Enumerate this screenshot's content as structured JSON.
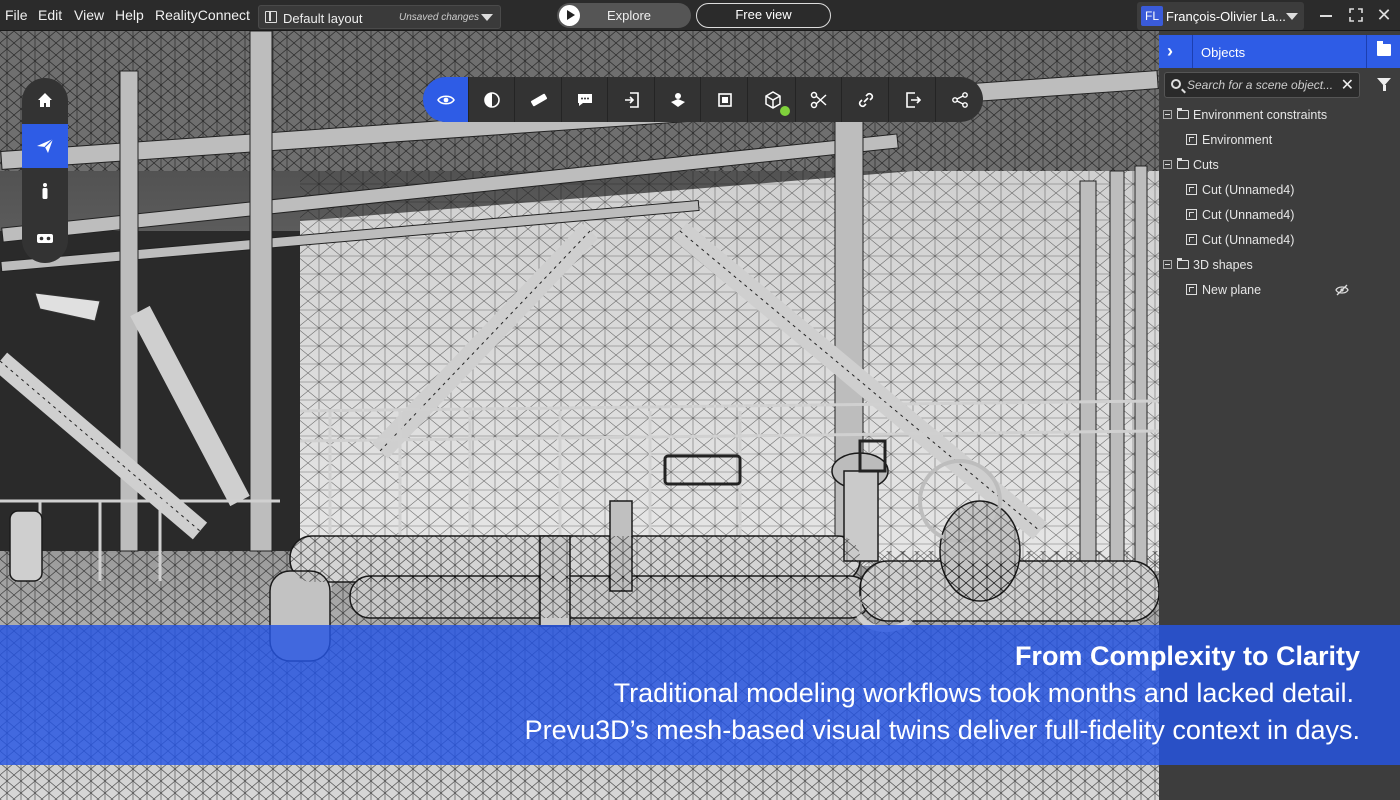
{
  "menu": {
    "file": "File",
    "edit": "Edit",
    "view": "View",
    "help": "Help",
    "reality_connect": "RealityConnect"
  },
  "layout": {
    "name": "Default layout",
    "status": "Unsaved changes"
  },
  "modes": {
    "explore": "Explore",
    "free_view": "Free view"
  },
  "user": {
    "initials": "FL",
    "name": "François-Olivier La..."
  },
  "left_nav": {
    "items": [
      "home-icon",
      "paper-plane-icon",
      "person-icon",
      "vr-headset-icon"
    ],
    "active": "paper-plane-icon"
  },
  "toolbar": {
    "tools": [
      "eye-icon",
      "contrast-icon",
      "ruler-icon",
      "comment-icon",
      "import-icon",
      "hotspot-icon",
      "frame-icon",
      "cube-icon",
      "scissors-icon",
      "link-icon",
      "export-icon",
      "share-icon"
    ],
    "active": "eye-icon",
    "status_dot_color": "#7fd13b"
  },
  "panel": {
    "title": "Objects",
    "search_placeholder": "Search for a scene object...",
    "tree": [
      {
        "type": "group",
        "label": "Environment constraints"
      },
      {
        "type": "item",
        "label": "Environment"
      },
      {
        "type": "group",
        "label": "Cuts"
      },
      {
        "type": "item",
        "label": "Cut (Unnamed4)"
      },
      {
        "type": "item",
        "label": "Cut (Unnamed4)"
      },
      {
        "type": "item",
        "label": "Cut (Unnamed4)"
      },
      {
        "type": "group",
        "label": "3D shapes"
      },
      {
        "type": "item",
        "label": "New plane",
        "hidden": true
      }
    ]
  },
  "banner": {
    "headline": "From Complexity to Clarity",
    "line1": "Traditional modeling workflows took months and lacked detail.",
    "line2": "Prevu3D’s mesh-based visual twins deliver full-fidelity context in days."
  },
  "colors": {
    "accent": "#2e5ce6",
    "menubar": "#2b2b2b",
    "panel": "#3d3d3d",
    "banner": "#2454e4"
  }
}
